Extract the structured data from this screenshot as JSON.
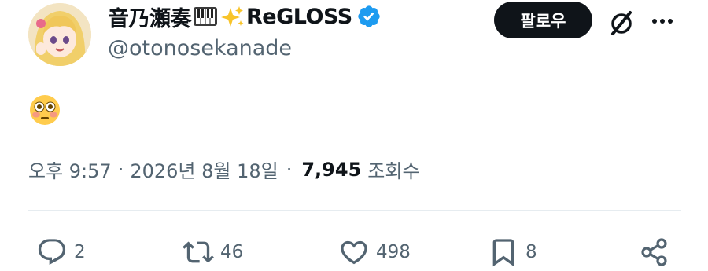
{
  "author": {
    "display_name": "音乃瀬奏",
    "affiliation": "ReGLOSS",
    "handle": "@otonosekanade",
    "verified": true,
    "badge_color": "#1d9bf0",
    "avatar_icon": "anime-avatar-blonde-girl"
  },
  "header": {
    "follow_label": "팔로우",
    "grok_icon": "slashed-circle-icon",
    "more_icon": "ellipsis-icon"
  },
  "tweet": {
    "content_emoji": "flushed-face-emoji",
    "time": "오후 9:57",
    "separator": "·",
    "date": "2026년 8월 18일",
    "views": "7,945",
    "views_label": "조회수"
  },
  "actions": {
    "replies": "2",
    "reposts": "46",
    "likes": "498",
    "bookmarks": "8",
    "share_icon": "share-icon"
  },
  "colors": {
    "text": "#0f1419",
    "secondary_text": "#536471",
    "follow_button_bg": "#0f1419",
    "divider": "#e6ecf0"
  }
}
